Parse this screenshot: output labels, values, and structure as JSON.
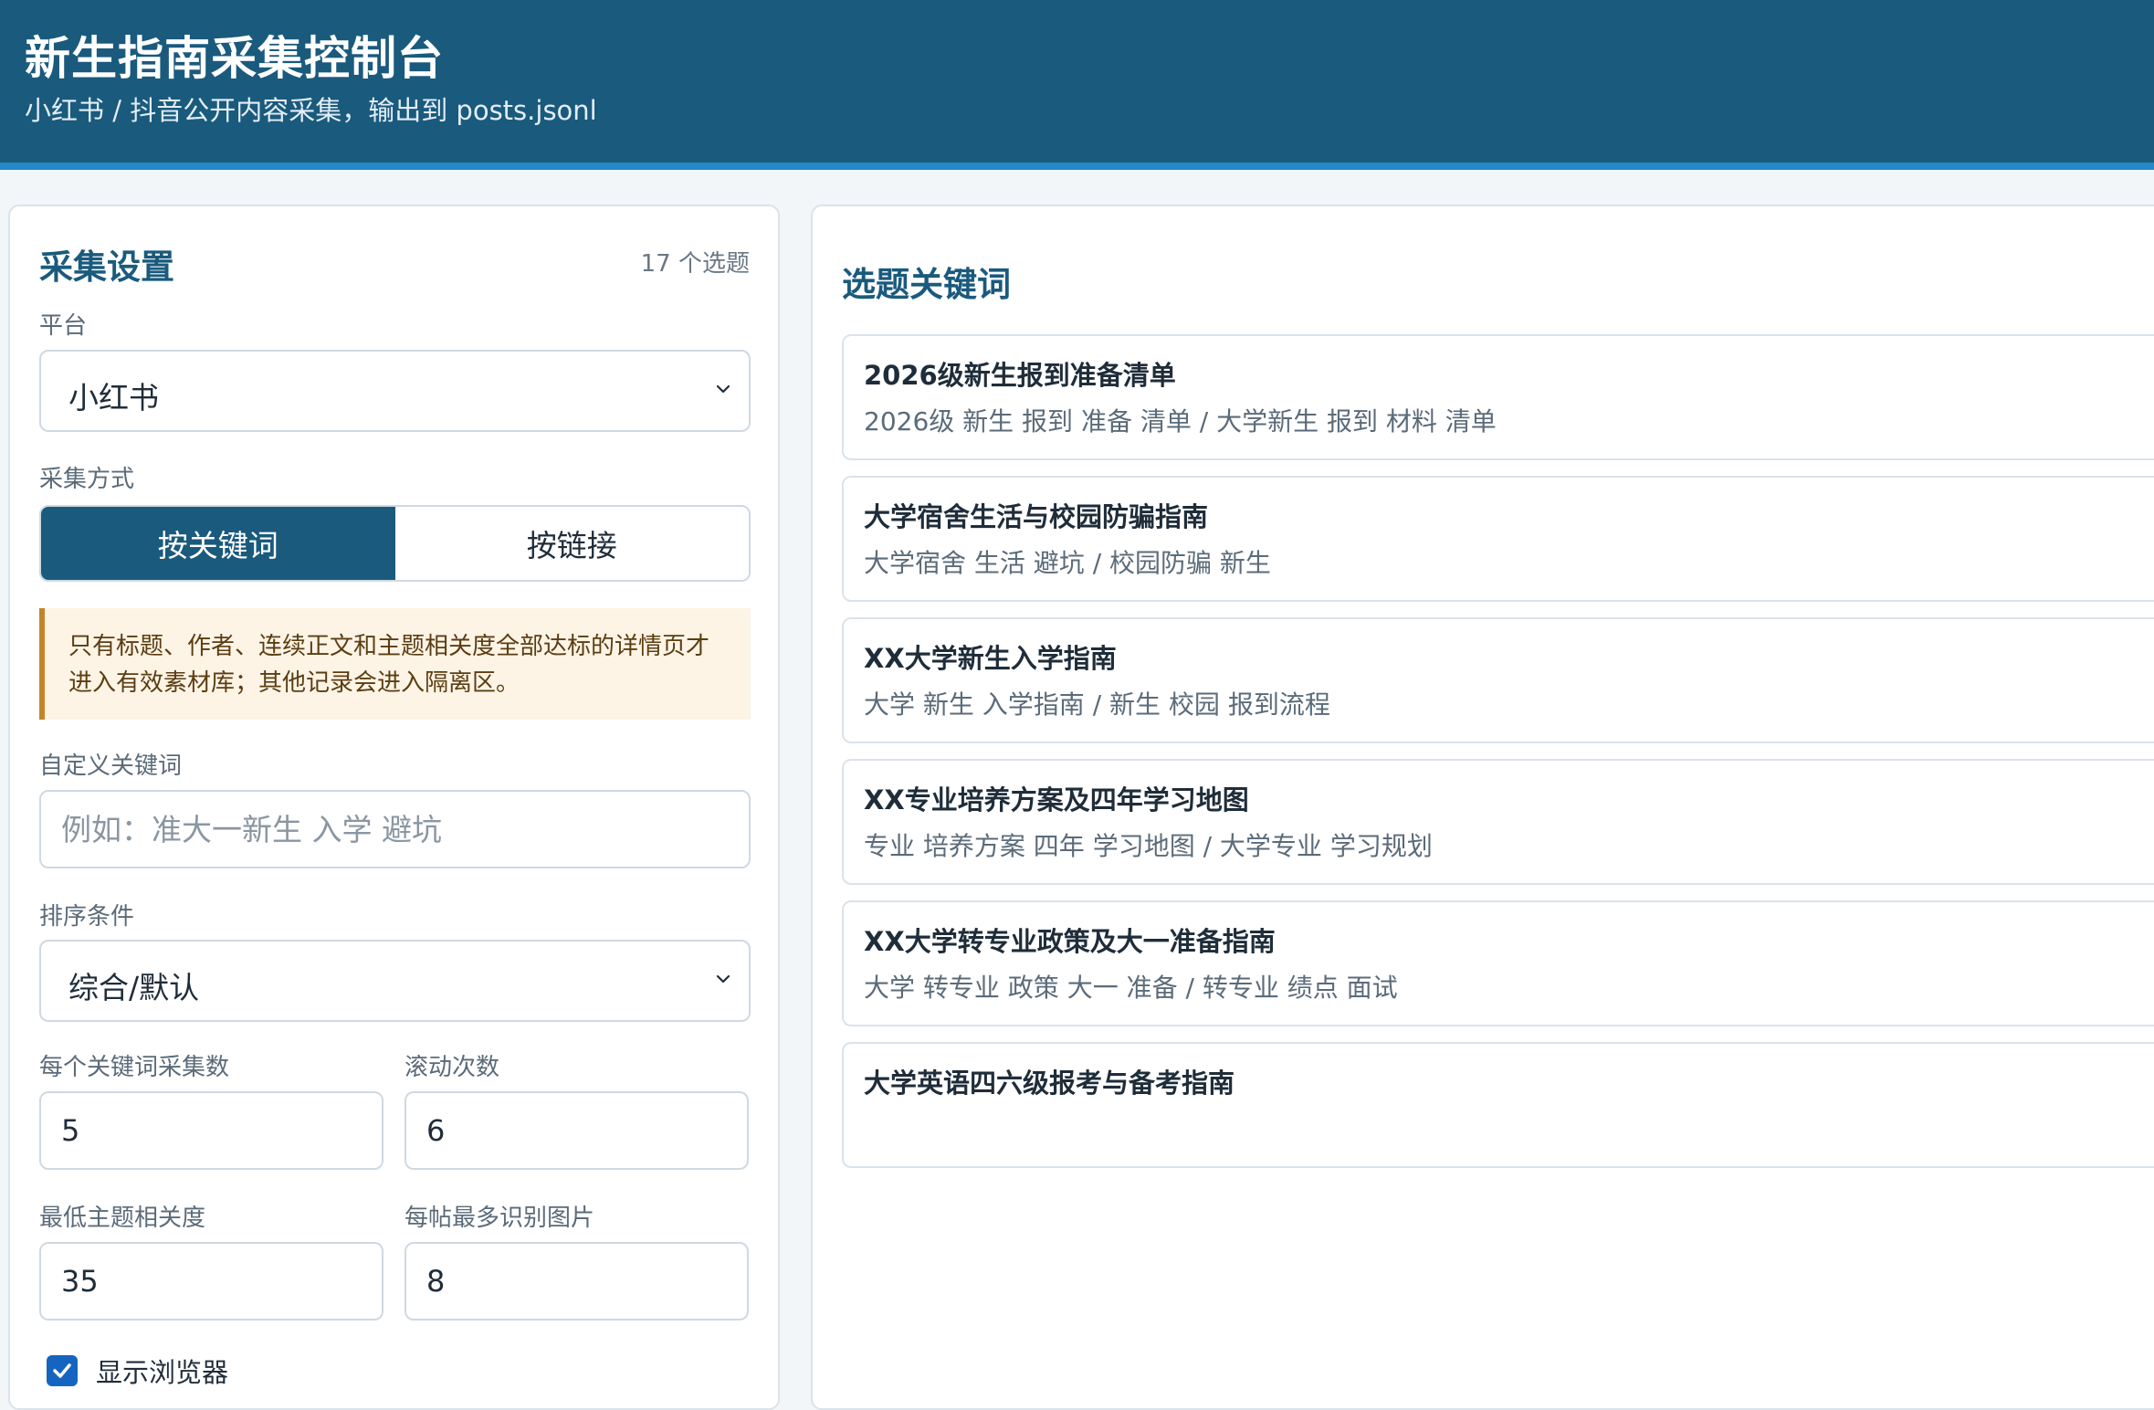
{
  "header": {
    "title": "新生指南采集控制台",
    "subtitle": "小红书 / 抖音公开内容采集，输出到 posts.jsonl"
  },
  "settings": {
    "title": "采集设置",
    "topic_count": "17 个选题",
    "platform": {
      "label": "平台",
      "value": "小红书"
    },
    "mode": {
      "label": "采集方式",
      "options": [
        "按关键词",
        "按链接"
      ],
      "active": "按关键词"
    },
    "notice": "只有标题、作者、连续正文和主题相关度全部达标的详情页才进入有效素材库；其他记录会进入隔离区。",
    "custom_keywords": {
      "label": "自定义关键词",
      "placeholder": "例如：准大一新生 入学 避坑"
    },
    "sort": {
      "label": "排序条件",
      "value": "综合/默认"
    },
    "per_keyword": {
      "label": "每个关键词采集数",
      "value": "5"
    },
    "scroll_times": {
      "label": "滚动次数",
      "value": "6"
    },
    "min_relevance": {
      "label": "最低主题相关度",
      "value": "35"
    },
    "max_images": {
      "label": "每帖最多识别图片",
      "value": "8"
    },
    "show_browser": {
      "label": "显示浏览器",
      "checked": true
    }
  },
  "topics": {
    "title": "选题关键词",
    "items": [
      {
        "title": "2026级新生报到准备清单",
        "keywords": "2026级 新生 报到 准备 清单 / 大学新生 报到 材料 清单"
      },
      {
        "title": "大学宿舍生活与校园防骗指南",
        "keywords": "大学宿舍 生活 避坑 / 校园防骗 新生"
      },
      {
        "title": "XX大学新生入学指南",
        "keywords": "大学 新生 入学指南 / 新生 校园 报到流程"
      },
      {
        "title": "XX专业培养方案及四年学习地图",
        "keywords": "专业 培养方案 四年 学习地图 / 大学专业 学习规划"
      },
      {
        "title": "XX大学转专业政策及大一准备指南",
        "keywords": "大学 转专业 政策 大一 准备 / 转专业 绩点 面试"
      },
      {
        "title": "大学英语四六级报考与备考指南",
        "keywords": ""
      }
    ]
  },
  "colors": {
    "header_bg": "#1a5a7d",
    "header_accent": "#2488c9",
    "primary": "#1a5a7d",
    "notice_border": "#c4842b",
    "notice_bg": "#fdf4e6",
    "checkbox": "#1565c0"
  }
}
